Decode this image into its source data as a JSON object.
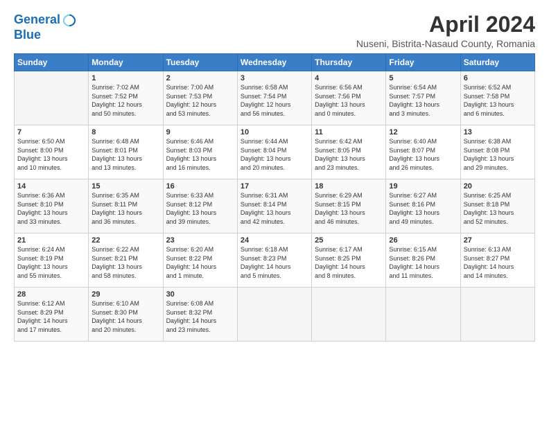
{
  "app": {
    "logo_line1": "General",
    "logo_line2": "Blue"
  },
  "calendar": {
    "title": "April 2024",
    "subtitle": "Nuseni, Bistrita-Nasaud County, Romania",
    "header": [
      "Sunday",
      "Monday",
      "Tuesday",
      "Wednesday",
      "Thursday",
      "Friday",
      "Saturday"
    ],
    "weeks": [
      [
        {
          "day": "",
          "info": ""
        },
        {
          "day": "1",
          "info": "Sunrise: 7:02 AM\nSunset: 7:52 PM\nDaylight: 12 hours\nand 50 minutes."
        },
        {
          "day": "2",
          "info": "Sunrise: 7:00 AM\nSunset: 7:53 PM\nDaylight: 12 hours\nand 53 minutes."
        },
        {
          "day": "3",
          "info": "Sunrise: 6:58 AM\nSunset: 7:54 PM\nDaylight: 12 hours\nand 56 minutes."
        },
        {
          "day": "4",
          "info": "Sunrise: 6:56 AM\nSunset: 7:56 PM\nDaylight: 13 hours\nand 0 minutes."
        },
        {
          "day": "5",
          "info": "Sunrise: 6:54 AM\nSunset: 7:57 PM\nDaylight: 13 hours\nand 3 minutes."
        },
        {
          "day": "6",
          "info": "Sunrise: 6:52 AM\nSunset: 7:58 PM\nDaylight: 13 hours\nand 6 minutes."
        }
      ],
      [
        {
          "day": "7",
          "info": "Sunrise: 6:50 AM\nSunset: 8:00 PM\nDaylight: 13 hours\nand 10 minutes."
        },
        {
          "day": "8",
          "info": "Sunrise: 6:48 AM\nSunset: 8:01 PM\nDaylight: 13 hours\nand 13 minutes."
        },
        {
          "day": "9",
          "info": "Sunrise: 6:46 AM\nSunset: 8:03 PM\nDaylight: 13 hours\nand 16 minutes."
        },
        {
          "day": "10",
          "info": "Sunrise: 6:44 AM\nSunset: 8:04 PM\nDaylight: 13 hours\nand 20 minutes."
        },
        {
          "day": "11",
          "info": "Sunrise: 6:42 AM\nSunset: 8:05 PM\nDaylight: 13 hours\nand 23 minutes."
        },
        {
          "day": "12",
          "info": "Sunrise: 6:40 AM\nSunset: 8:07 PM\nDaylight: 13 hours\nand 26 minutes."
        },
        {
          "day": "13",
          "info": "Sunrise: 6:38 AM\nSunset: 8:08 PM\nDaylight: 13 hours\nand 29 minutes."
        }
      ],
      [
        {
          "day": "14",
          "info": "Sunrise: 6:36 AM\nSunset: 8:10 PM\nDaylight: 13 hours\nand 33 minutes."
        },
        {
          "day": "15",
          "info": "Sunrise: 6:35 AM\nSunset: 8:11 PM\nDaylight: 13 hours\nand 36 minutes."
        },
        {
          "day": "16",
          "info": "Sunrise: 6:33 AM\nSunset: 8:12 PM\nDaylight: 13 hours\nand 39 minutes."
        },
        {
          "day": "17",
          "info": "Sunrise: 6:31 AM\nSunset: 8:14 PM\nDaylight: 13 hours\nand 42 minutes."
        },
        {
          "day": "18",
          "info": "Sunrise: 6:29 AM\nSunset: 8:15 PM\nDaylight: 13 hours\nand 46 minutes."
        },
        {
          "day": "19",
          "info": "Sunrise: 6:27 AM\nSunset: 8:16 PM\nDaylight: 13 hours\nand 49 minutes."
        },
        {
          "day": "20",
          "info": "Sunrise: 6:25 AM\nSunset: 8:18 PM\nDaylight: 13 hours\nand 52 minutes."
        }
      ],
      [
        {
          "day": "21",
          "info": "Sunrise: 6:24 AM\nSunset: 8:19 PM\nDaylight: 13 hours\nand 55 minutes."
        },
        {
          "day": "22",
          "info": "Sunrise: 6:22 AM\nSunset: 8:21 PM\nDaylight: 13 hours\nand 58 minutes."
        },
        {
          "day": "23",
          "info": "Sunrise: 6:20 AM\nSunset: 8:22 PM\nDaylight: 14 hours\nand 1 minute."
        },
        {
          "day": "24",
          "info": "Sunrise: 6:18 AM\nSunset: 8:23 PM\nDaylight: 14 hours\nand 5 minutes."
        },
        {
          "day": "25",
          "info": "Sunrise: 6:17 AM\nSunset: 8:25 PM\nDaylight: 14 hours\nand 8 minutes."
        },
        {
          "day": "26",
          "info": "Sunrise: 6:15 AM\nSunset: 8:26 PM\nDaylight: 14 hours\nand 11 minutes."
        },
        {
          "day": "27",
          "info": "Sunrise: 6:13 AM\nSunset: 8:27 PM\nDaylight: 14 hours\nand 14 minutes."
        }
      ],
      [
        {
          "day": "28",
          "info": "Sunrise: 6:12 AM\nSunset: 8:29 PM\nDaylight: 14 hours\nand 17 minutes."
        },
        {
          "day": "29",
          "info": "Sunrise: 6:10 AM\nSunset: 8:30 PM\nDaylight: 14 hours\nand 20 minutes."
        },
        {
          "day": "30",
          "info": "Sunrise: 6:08 AM\nSunset: 8:32 PM\nDaylight: 14 hours\nand 23 minutes."
        },
        {
          "day": "",
          "info": ""
        },
        {
          "day": "",
          "info": ""
        },
        {
          "day": "",
          "info": ""
        },
        {
          "day": "",
          "info": ""
        }
      ]
    ]
  }
}
